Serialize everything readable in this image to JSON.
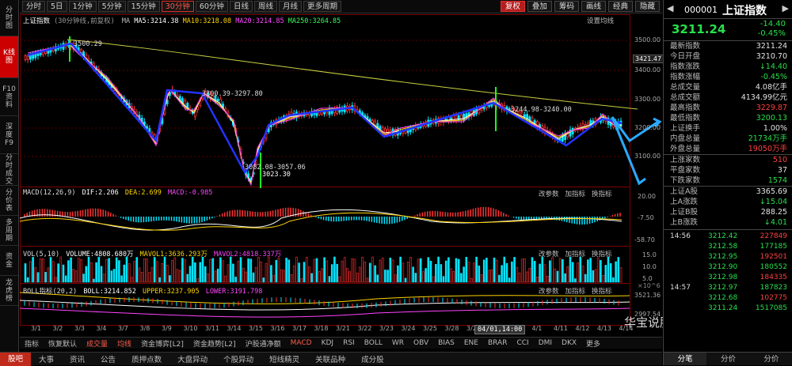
{
  "left_nav": [
    "分时图",
    "K线图",
    "F10资料",
    "深度F9",
    "分时成交",
    "分价表",
    "多周期",
    "资金",
    "龙虎榜"
  ],
  "left_nav_active": 1,
  "period_tabs": [
    "分时",
    "5日",
    "1分钟",
    "5分钟",
    "15分钟",
    "30分钟",
    "60分钟",
    "日线",
    "周线",
    "月线",
    "更多周期"
  ],
  "period_active": 5,
  "right_tools": [
    "复权",
    "叠加",
    "筹码",
    "画线",
    "经典",
    "隐藏"
  ],
  "main_header": {
    "name": "上证指数",
    "period": "(30分钟线,前复权)",
    "ma_prefix": "MA",
    "ma5": "MA5:3214.38",
    "ma10": "MA10:3218.08",
    "ma20": "MA20:3214.85",
    "ma250": "MA250:3264.85",
    "settings": "设置均线"
  },
  "main_axis": [
    "3500.00",
    "3400.00",
    "3300.00",
    "3200.00",
    "3100.00"
  ],
  "current_price_tag": "3421.47",
  "annotations": {
    "high": "3500.29",
    "mid": "3300.39-3297.80",
    "low1": "3082.08-3057.06",
    "low2": "3023.30",
    "right": "3244.98-3240.00"
  },
  "macd": {
    "label": "MACD(12,26,9)",
    "dif": "DIF:2.206",
    "dea": "DEA:2.699",
    "macd": "MACD:-0.985",
    "axis": [
      "20.00",
      "-7.50",
      "-58.70"
    ],
    "tools": [
      "改参数",
      "加指标",
      "换指标"
    ]
  },
  "vol": {
    "label": "VOL(5,10)",
    "volume": "VOLUME:4808.680万",
    "mavol1": "MAVOL1:3636.293万",
    "mavol2": "MAVOL2:4818.337万",
    "axis": [
      "15.0",
      "10.0",
      "5.0"
    ],
    "unit": "×10^6",
    "tools": [
      "改参数",
      "加指标",
      "换指标"
    ]
  },
  "boll": {
    "label": "BOLL指标(20,2)",
    "boll": "BOLL:3214.852",
    "upper": "UPPER:3237.905",
    "lower": "LOWER:3191.798",
    "axis": [
      "3521.36",
      "2997.54"
    ],
    "tools": [
      "改参数",
      "加指标",
      "换指标"
    ]
  },
  "date_axis": [
    "3/1",
    "3/2",
    "3/3",
    "3/4",
    "3/7",
    "3/8",
    "3/9",
    "3/10",
    "3/11",
    "3/14",
    "3/15",
    "3/16",
    "3/17",
    "3/18",
    "3/21",
    "3/22",
    "3/23",
    "3/24",
    "3/25",
    "3/28",
    "3/29",
    "3/30",
    "3/31",
    "4/1",
    "4/11",
    "4/12",
    "4/13",
    "4/14"
  ],
  "cursor_time": "04/01,14:00",
  "indicator_tabs": [
    "指标",
    "恢复默认",
    "成交量",
    "均线",
    "资金博弈[L2]",
    "资金趋势[L2]",
    "沪股通净额",
    "MACD",
    "KDJ",
    "RSI",
    "BOLL",
    "WR",
    "OBV",
    "BIAS",
    "ENE",
    "BRAR",
    "CCI",
    "DMI",
    "DKX",
    "更多"
  ],
  "indicator_active": [
    2,
    3,
    7
  ],
  "bottom_tabs": [
    "股吧",
    "大事",
    "资讯",
    "公告",
    "质押点数",
    "大盘异动",
    "个股异动",
    "短线精灵",
    "关联品种",
    "成分股"
  ],
  "bottom_active": 0,
  "watermark": "华宝说股论基",
  "quote": {
    "code": "000001",
    "name": "上证指数",
    "price": "3211.24",
    "change": "-14.40",
    "pct": "-0.45%",
    "stats": [
      {
        "k": "最新指数",
        "v": "3211.24",
        "c": "#e5e5e5"
      },
      {
        "k": "今日开盘",
        "v": "3210.70",
        "c": "#e5e5e5"
      },
      {
        "k": "指数涨跌",
        "v": "↓14.40",
        "c": "#28e04b"
      },
      {
        "k": "指数涨幅",
        "v": "-0.45%",
        "c": "#28e04b"
      },
      {
        "k": "总成交量",
        "v": "4.08亿手",
        "c": "#e5e5e5"
      },
      {
        "k": "总成交额",
        "v": "4134.99亿元",
        "c": "#e5e5e5"
      },
      {
        "k": "最高指数",
        "v": "3229.87",
        "c": "#ff4040"
      },
      {
        "k": "最低指数",
        "v": "3200.13",
        "c": "#28e04b"
      },
      {
        "k": "上证换手",
        "v": "1.00%",
        "c": "#e5e5e5"
      },
      {
        "k": "内盘总量",
        "v": "21734万手",
        "c": "#28e04b"
      },
      {
        "k": "外盘总量",
        "v": "19050万手",
        "c": "#ff4040"
      }
    ],
    "breadth": [
      {
        "k": "上涨家数",
        "v": "510",
        "c": "#ff4040"
      },
      {
        "k": "平盘家数",
        "v": "37",
        "c": "#e5e5e5"
      },
      {
        "k": "下跌家数",
        "v": "1574",
        "c": "#28e04b"
      }
    ],
    "boards": [
      {
        "k": "上证A股",
        "v": "3365.69",
        "c": "#e5e5e5"
      },
      {
        "k": "上A涨跌",
        "v": "↓15.04",
        "c": "#28e04b"
      },
      {
        "k": "上证B股",
        "v": "288.25",
        "c": "#e5e5e5"
      },
      {
        "k": "上B涨跌",
        "v": "↓4.01",
        "c": "#28e04b"
      }
    ],
    "ticks": [
      {
        "t": "14:56",
        "p": "3212.42",
        "v": "227849"
      },
      {
        "t": "",
        "p": "3212.58",
        "v": "177185"
      },
      {
        "t": "",
        "p": "3212.95",
        "v": "192501"
      },
      {
        "t": "",
        "p": "3212.90",
        "v": "180552"
      },
      {
        "t": "",
        "p": "3212.98",
        "v": "184335"
      },
      {
        "t": "14:57",
        "p": "3212.97",
        "v": "187823"
      },
      {
        "t": "",
        "p": "3212.68",
        "v": "102775"
      },
      {
        "t": "",
        "p": "3211.24",
        "v": "1517085"
      }
    ],
    "tabs": [
      "分笔",
      "分价",
      "分价"
    ]
  }
}
